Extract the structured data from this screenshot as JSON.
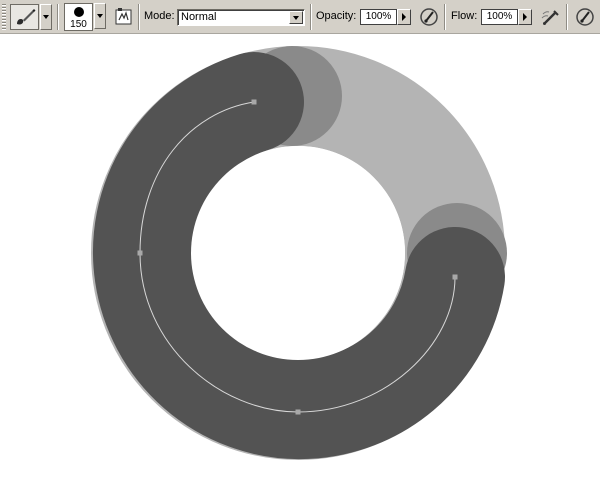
{
  "toolbar": {
    "tool_icon": "brush-tool-icon",
    "brush_size": "150",
    "brush_panel_icon": "brush-panel-icon",
    "mode_label": "Mode:",
    "mode_value": "Normal",
    "opacity_label": "Opacity:",
    "opacity_value": "100%",
    "opacity_pressure_icon": "pressure-opacity-icon",
    "flow_label": "Flow:",
    "flow_value": "100%",
    "airbrush_icon": "airbrush-icon",
    "pressure_size_icon": "pressure-size-icon"
  },
  "canvas": {
    "colors": {
      "background": "#ffffff",
      "dark_stroke": "#535353",
      "mid_stroke": "#8a8a8a",
      "light_stroke": "#b4b4b4",
      "path": "#d8d8d8",
      "anchor": "#a8a8a8"
    }
  }
}
